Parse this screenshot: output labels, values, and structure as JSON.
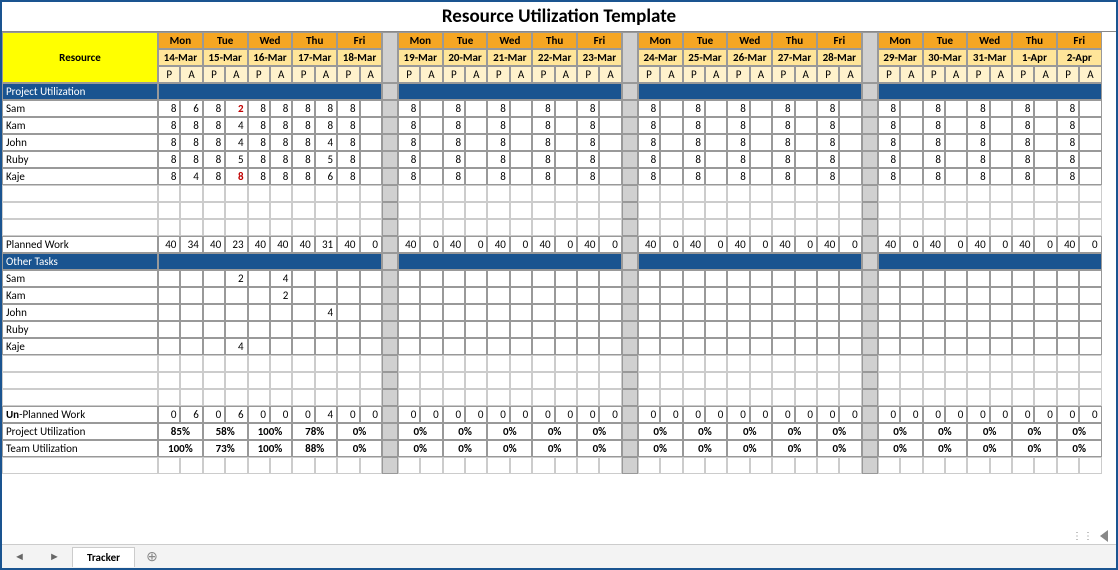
{
  "title": "Resource Utilization Template",
  "resource_label": "Resource",
  "weeks": [
    {
      "days": [
        "Mon",
        "Tue",
        "Wed",
        "Thu",
        "Fri"
      ],
      "dates": [
        "14-Mar",
        "15-Mar",
        "16-Mar",
        "17-Mar",
        "18-Mar"
      ]
    },
    {
      "days": [
        "Mon",
        "Tue",
        "Wed",
        "Thu",
        "Fri"
      ],
      "dates": [
        "19-Mar",
        "20-Mar",
        "21-Mar",
        "22-Mar",
        "23-Mar"
      ]
    },
    {
      "days": [
        "Mon",
        "Tue",
        "Wed",
        "Thu",
        "Fri"
      ],
      "dates": [
        "24-Mar",
        "25-Mar",
        "26-Mar",
        "27-Mar",
        "28-Mar"
      ]
    },
    {
      "days": [
        "Mon",
        "Tue",
        "Wed",
        "Thu",
        "Fri"
      ],
      "dates": [
        "29-Mar",
        "30-Mar",
        "31-Mar",
        "1-Apr",
        "2-Apr"
      ]
    }
  ],
  "pa": [
    "P",
    "A"
  ],
  "sections": {
    "project_utilization": "Project Utilization",
    "other_tasks": "Other Tasks"
  },
  "resources": [
    "Sam",
    "Kam",
    "John",
    "Ruby",
    "Kaje"
  ],
  "project_rows": [
    {
      "name": "Sam",
      "w1": [
        [
          "8",
          "6"
        ],
        [
          "8",
          "2"
        ],
        [
          "8",
          "8"
        ],
        [
          "8",
          "8"
        ],
        [
          "8",
          ""
        ]
      ],
      "p_only": [
        [
          "8",
          "8",
          "8",
          "8",
          "8"
        ],
        [
          "8",
          "8",
          "8",
          "8",
          "8"
        ],
        [
          "8",
          "8",
          "8",
          "8",
          "8"
        ]
      ],
      "red": [
        1
      ]
    },
    {
      "name": "Kam",
      "w1": [
        [
          "8",
          "8"
        ],
        [
          "8",
          "4"
        ],
        [
          "8",
          "8"
        ],
        [
          "8",
          "8"
        ],
        [
          "8",
          ""
        ]
      ],
      "p_only": [
        [
          "8",
          "8",
          "8",
          "8",
          "8"
        ],
        [
          "8",
          "8",
          "8",
          "8",
          "8"
        ],
        [
          "8",
          "8",
          "8",
          "8",
          "8"
        ]
      ]
    },
    {
      "name": "John",
      "w1": [
        [
          "8",
          "8"
        ],
        [
          "8",
          "4"
        ],
        [
          "8",
          "8"
        ],
        [
          "8",
          "4"
        ],
        [
          "8",
          ""
        ]
      ],
      "p_only": [
        [
          "8",
          "8",
          "8",
          "8",
          "8"
        ],
        [
          "8",
          "8",
          "8",
          "8",
          "8"
        ],
        [
          "8",
          "8",
          "8",
          "8",
          "8"
        ]
      ]
    },
    {
      "name": "Ruby",
      "w1": [
        [
          "8",
          "8"
        ],
        [
          "8",
          "5"
        ],
        [
          "8",
          "8"
        ],
        [
          "8",
          "5"
        ],
        [
          "8",
          ""
        ]
      ],
      "p_only": [
        [
          "8",
          "8",
          "8",
          "8",
          "8"
        ],
        [
          "8",
          "8",
          "8",
          "8",
          "8"
        ],
        [
          "8",
          "8",
          "8",
          "8",
          "8"
        ]
      ]
    },
    {
      "name": "Kaje",
      "w1": [
        [
          "8",
          "4"
        ],
        [
          "8",
          "8"
        ],
        [
          "8",
          "8"
        ],
        [
          "8",
          "6"
        ],
        [
          "8",
          ""
        ]
      ],
      "p_only": [
        [
          "8",
          "8",
          "8",
          "8",
          "8"
        ],
        [
          "8",
          "8",
          "8",
          "8",
          "8"
        ],
        [
          "8",
          "8",
          "8",
          "8",
          "8"
        ]
      ],
      "red": [
        1
      ]
    }
  ],
  "planned_work": {
    "label": "Planned Work",
    "w1": [
      [
        "40",
        "34"
      ],
      [
        "40",
        "23"
      ],
      [
        "40",
        "40"
      ],
      [
        "40",
        "31"
      ],
      [
        "40",
        "0"
      ]
    ],
    "rest": [
      [
        "40",
        "0"
      ],
      [
        "40",
        "0"
      ],
      [
        "40",
        "0"
      ],
      [
        "40",
        "0"
      ],
      [
        "40",
        "0"
      ]
    ]
  },
  "other_rows": [
    {
      "name": "Sam",
      "w1": [
        [
          "",
          ""
        ],
        [
          "",
          "2"
        ],
        [
          "",
          "4"
        ],
        [
          "",
          ""
        ],
        [
          "",
          ""
        ]
      ]
    },
    {
      "name": "Kam",
      "w1": [
        [
          "",
          ""
        ],
        [
          "",
          ""
        ],
        [
          "",
          "2"
        ],
        [
          "",
          ""
        ],
        [
          "",
          ""
        ]
      ]
    },
    {
      "name": "John",
      "w1": [
        [
          "",
          ""
        ],
        [
          "",
          ""
        ],
        [
          "",
          ""
        ],
        [
          "",
          "4"
        ],
        [
          "",
          ""
        ]
      ]
    },
    {
      "name": "Ruby",
      "w1": [
        [
          "",
          ""
        ],
        [
          "",
          ""
        ],
        [
          "",
          ""
        ],
        [
          "",
          ""
        ],
        [
          "",
          ""
        ]
      ]
    },
    {
      "name": "Kaje",
      "w1": [
        [
          "",
          ""
        ],
        [
          "",
          "4"
        ],
        [
          "",
          ""
        ],
        [
          "",
          ""
        ],
        [
          "",
          ""
        ]
      ]
    }
  ],
  "unplanned_work": {
    "label_html": "Un-Planned Work",
    "w1": [
      [
        "0",
        "6"
      ],
      [
        "0",
        "6"
      ],
      [
        "0",
        "0"
      ],
      [
        "0",
        "4"
      ],
      [
        "0",
        "0"
      ]
    ],
    "rest": [
      [
        "0",
        "0"
      ],
      [
        "0",
        "0"
      ],
      [
        "0",
        "0"
      ],
      [
        "0",
        "0"
      ],
      [
        "0",
        "0"
      ]
    ]
  },
  "proj_util_row": {
    "label": "Project Utilization",
    "w1": [
      "85%",
      "58%",
      "100%",
      "78%",
      "0%"
    ],
    "rest": [
      "0%",
      "0%",
      "0%",
      "0%",
      "0%"
    ]
  },
  "team_util_row": {
    "label": "Team Utilization",
    "w1": [
      "100%",
      "73%",
      "100%",
      "88%",
      "0%"
    ],
    "rest": [
      "0%",
      "0%",
      "0%",
      "0%",
      "0%"
    ]
  },
  "tab": "Tracker"
}
